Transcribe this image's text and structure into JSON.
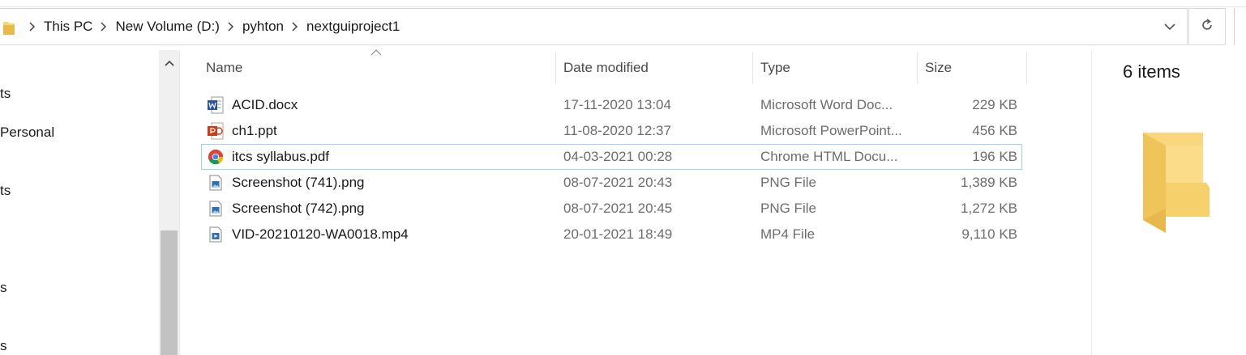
{
  "address_bar": {
    "crumbs": [
      "This PC",
      "New Volume (D:)",
      "pyhton",
      "nextguiproject1"
    ]
  },
  "nav_pane": {
    "items": [
      "ts",
      "Personal",
      "ts",
      "s",
      "s"
    ]
  },
  "columns": {
    "name": "Name",
    "date": "Date modified",
    "type": "Type",
    "size": "Size"
  },
  "files": [
    {
      "name": "ACID.docx",
      "date": "17-11-2020 13:04",
      "type": "Microsoft Word Doc...",
      "size": "229 KB",
      "icon": "word-doc-icon"
    },
    {
      "name": "ch1.ppt",
      "date": "11-08-2020 12:37",
      "type": "Microsoft PowerPoint...",
      "size": "456 KB",
      "icon": "powerpoint-icon"
    },
    {
      "name": "itcs syllabus.pdf",
      "date": "04-03-2021 00:28",
      "type": "Chrome HTML Docu...",
      "size": "196 KB",
      "icon": "chrome-icon"
    },
    {
      "name": "Screenshot (741).png",
      "date": "08-07-2021 20:43",
      "type": "PNG File",
      "size": "1,389 KB",
      "icon": "image-file-icon"
    },
    {
      "name": "Screenshot (742).png",
      "date": "08-07-2021 20:45",
      "type": "PNG File",
      "size": "1,272 KB",
      "icon": "image-file-icon"
    },
    {
      "name": "VID-20210120-WA0018.mp4",
      "date": "20-01-2021 18:49",
      "type": "MP4 File",
      "size": "9,110 KB",
      "icon": "video-file-icon"
    }
  ],
  "details_pane": {
    "count": "6 items"
  },
  "colors": {
    "selection_border": "#99d1ff",
    "folder_yellow": "#f8d775",
    "word_blue": "#2b579a",
    "ppt_orange": "#c43e1c"
  }
}
